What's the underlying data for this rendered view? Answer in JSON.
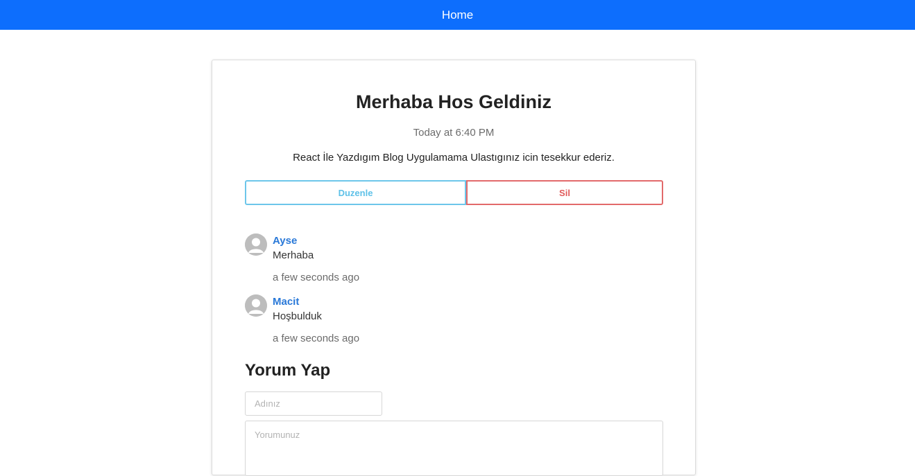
{
  "nav": {
    "home_label": "Home",
    "bar_color": "#0d6efd"
  },
  "post": {
    "title": "Merhaba Hos Geldiniz",
    "date": "Today at 6:40 PM",
    "body": "React İle Yazdıgım Blog Uygulamama Ulastıgınız icin tesekkur ederiz.",
    "edit_label": "Duzenle",
    "delete_label": "Sil",
    "edit_color": "#5ec1e8",
    "delete_color": "#e05a5a"
  },
  "comments": [
    {
      "author": "Ayse",
      "text": "Merhaba",
      "time": "a few seconds ago",
      "avatar_icon": "user-avatar-icon"
    },
    {
      "author": "Macit",
      "text": "Hoşbulduk",
      "time": "a few seconds ago",
      "avatar_icon": "user-avatar-icon"
    }
  ],
  "comment_form": {
    "title": "Yorum Yap",
    "name_placeholder": "Adınız",
    "comment_placeholder": "Yorumunuz"
  }
}
